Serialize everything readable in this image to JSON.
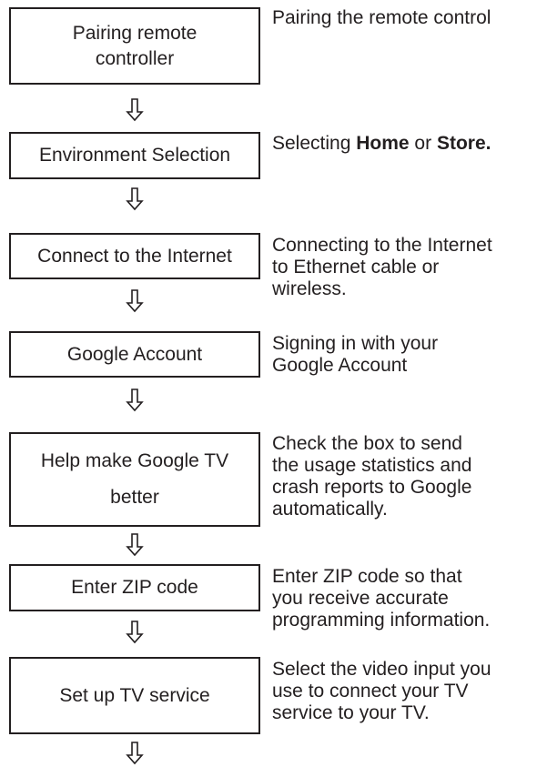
{
  "steps": [
    {
      "box": "Pairing remote\ncontroller",
      "description": "Pairing the remote control"
    },
    {
      "box": "Environment Selection",
      "description_parts": [
        "Selecting ",
        "Home",
        " or ",
        "Store."
      ]
    },
    {
      "box": "Connect to the Internet",
      "description": "Connecting to the Internet\nto Ethernet cable or\nwireless."
    },
    {
      "box": "Google Account",
      "description": "Signing in with your\nGoogle Account"
    },
    {
      "box": "Help make Google TV\nbetter",
      "description": "Check the box to send\nthe usage statistics and\ncrash reports to Google\nautomatically."
    },
    {
      "box": "Enter ZIP code",
      "description": "Enter ZIP code so that\nyou receive accurate\nprogramming information."
    },
    {
      "box": "Set up TV service",
      "description": "Select the video input you\nuse to connect your TV\nservice to your TV."
    }
  ],
  "arrow_icon": "down-outline-arrow-icon"
}
